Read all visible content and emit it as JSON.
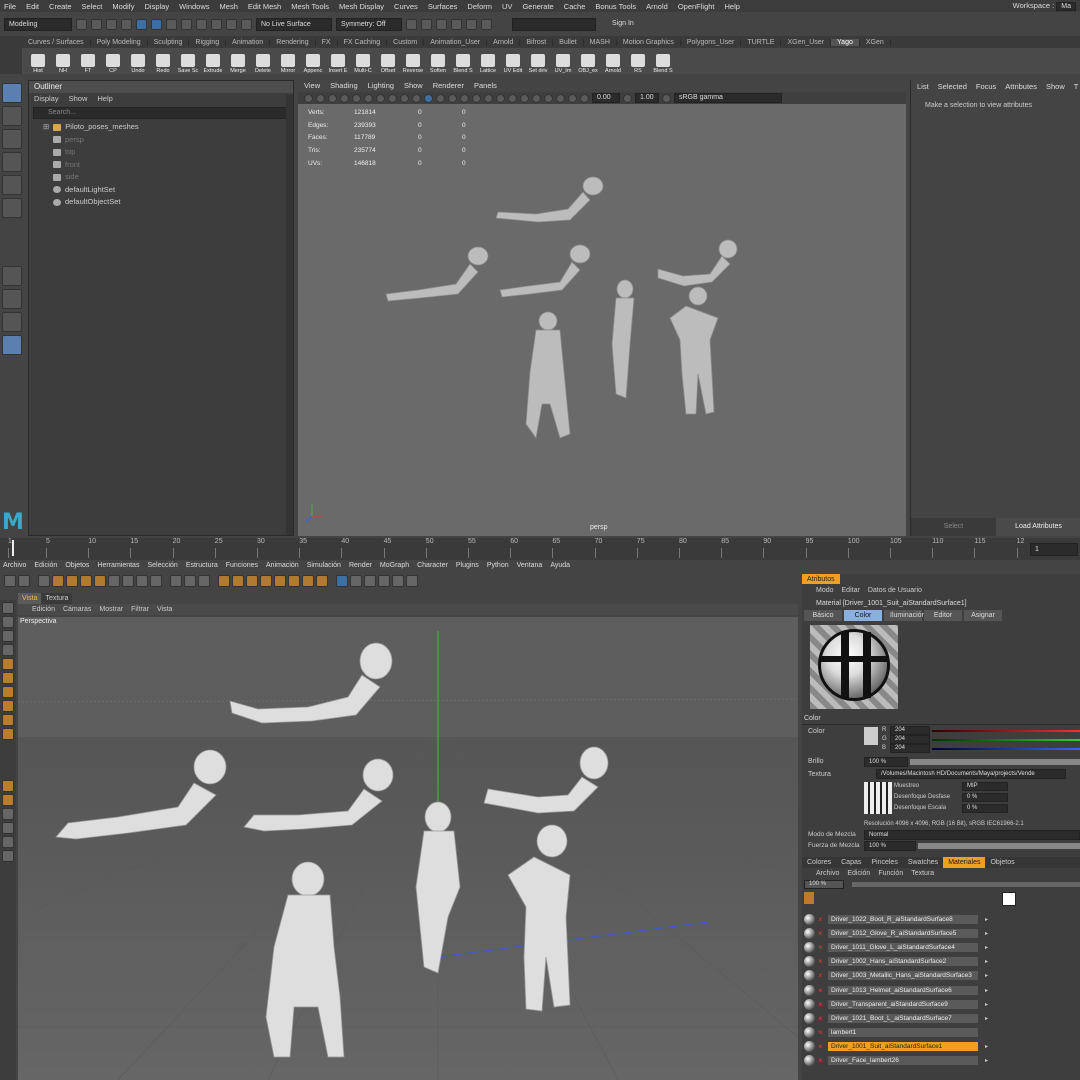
{
  "maya": {
    "menu": [
      "File",
      "Edit",
      "Create",
      "Select",
      "Modify",
      "Display",
      "Windows",
      "Mesh",
      "Edit Mesh",
      "Mesh Tools",
      "Mesh Display",
      "Curves",
      "Surfaces",
      "Deform",
      "UV",
      "Generate",
      "Cache",
      "Bonus Tools",
      "Arnold",
      "OpenFlight",
      "Help"
    ],
    "workspace": "Workspace :",
    "workspace_value": "Ma",
    "mode": "Modeling",
    "live_surface": "No Live Surface",
    "symmetry": "Symmetry: Off",
    "sign_in": "Sign In",
    "shelf_tabs": [
      "Curves / Surfaces",
      "Poly Modeling",
      "Sculpting",
      "Rigging",
      "Animation",
      "Rendering",
      "FX",
      "FX Caching",
      "Custom",
      "Animation_User",
      "Arnold",
      "Bifrost",
      "Bullet",
      "MASH",
      "Motion Graphics",
      "Polygons_User",
      "TURTLE",
      "XGen_User",
      "Yago",
      "XGen"
    ],
    "active_shelf_tab": "Yago",
    "shelf_buttons": [
      "Hist",
      "NH",
      "FT",
      "CP",
      "Undo",
      "Redo",
      "Save Sc",
      "Extrude",
      "Merge",
      "Delete",
      "Mirror",
      "Appenc",
      "Insert E",
      "Multi-C",
      "Offset",
      "Reverse",
      "Soften",
      "Blend S",
      "Lattice",
      "UV Edit",
      "Set driv",
      "UV_Im",
      "OBJ_ex",
      "Arnold",
      "RS",
      "Blend S"
    ],
    "outliner": {
      "title": "Outliner",
      "menu": [
        "Display",
        "Show",
        "Help"
      ],
      "search_placeholder": "Search...",
      "items": [
        {
          "label": "Piloto_poses_meshes",
          "type": "group"
        },
        {
          "label": "persp",
          "type": "camera"
        },
        {
          "label": "top",
          "type": "camera"
        },
        {
          "label": "front",
          "type": "camera"
        },
        {
          "label": "side",
          "type": "camera"
        },
        {
          "label": "defaultLightSet",
          "type": "set"
        },
        {
          "label": "defaultObjectSet",
          "type": "set"
        }
      ]
    },
    "viewport": {
      "menu": [
        "View",
        "Shading",
        "Lighting",
        "Show",
        "Renderer",
        "Panels"
      ],
      "exposure": "0.00",
      "gamma": "1.00",
      "color_space": "sRGB gamma",
      "camera_label": "persp",
      "stats": [
        {
          "name": "Verts:",
          "value": "121814",
          "sel": "0",
          "comp": "0"
        },
        {
          "name": "Edges:",
          "value": "239393",
          "sel": "0",
          "comp": "0"
        },
        {
          "name": "Faces:",
          "value": "117789",
          "sel": "0",
          "comp": "0"
        },
        {
          "name": "Tris:",
          "value": "235774",
          "sel": "0",
          "comp": "0"
        },
        {
          "name": "UVs:",
          "value": "146818",
          "sel": "0",
          "comp": "0"
        }
      ]
    },
    "attribute_editor": {
      "menu": [
        "List",
        "Selected",
        "Focus",
        "Attributes",
        "Show",
        "T"
      ],
      "message": "Make a selection to view attributes",
      "select_btn": "Select",
      "load_btn": "Load Attributes"
    },
    "timeline": {
      "ticks": [
        "1",
        "5",
        "10",
        "15",
        "20",
        "25",
        "30",
        "35",
        "40",
        "45",
        "50",
        "55",
        "60",
        "65",
        "70",
        "75",
        "80",
        "85",
        "90",
        "95",
        "100",
        "105",
        "110",
        "115",
        "12"
      ],
      "current_frame": "1"
    }
  },
  "c4d": {
    "menu": [
      "Archivo",
      "Edición",
      "Objetos",
      "Herramientas",
      "Selección",
      "Estructura",
      "Funciones",
      "Animación",
      "Simulación",
      "Render",
      "MoGraph",
      "Character",
      "Plugins",
      "Python",
      "Ventana",
      "Ayuda"
    ],
    "vp_tabs": [
      "Vista",
      "Textura"
    ],
    "vp_menu": [
      "Edición",
      "Cámaras",
      "Mostrar",
      "Filtrar",
      "Vista"
    ],
    "vp_label": "Perspectiva",
    "attributes": {
      "title": "Atributos",
      "menu": [
        "Modo",
        "Editar",
        "Datos de Usuario"
      ],
      "material_title": "Material [Driver_1001_Suit_aiStandardSurface1]",
      "tabs": [
        "Básico",
        "Color",
        "Iluminación",
        "Editor",
        "Asignar"
      ],
      "active_tab": "Color",
      "section": "Color",
      "color_label": "Color",
      "r": "204",
      "g": "204",
      "b": "204",
      "brillo_label": "Brillo",
      "brillo_value": "100 %",
      "brillo_fraction": 1.0,
      "textura_label": "Textura",
      "textura_path": "/Volumes/Macintosh HD/Documents/Maya/projects/Vende",
      "muestreo_label": "Muestreo",
      "muestreo_value": "MIP",
      "desenfoque_desfase_label": "Desenfoque Desfase",
      "desenfoque_desfase_value": "0 %",
      "desenfoque_escala_label": "Desenfoque Escala",
      "desenfoque_escala_value": "0 %",
      "resolucion": "Resolución 4096 x 4096, RGB (16 Bit), sRGB IEC61966-2.1",
      "modo_mezcla_label": "Modo de Mezcla",
      "modo_mezcla_value": "Normal",
      "fuerza_mezcla_label": "Fuerza de Mezcla",
      "fuerza_mezcla_value": "100 %"
    },
    "bottom_tabs": [
      "Colores",
      "Capas",
      "Pinceles",
      "Swatches",
      "Materiales",
      "Objetos"
    ],
    "active_bottom_tab": "Materiales",
    "mat_menu": [
      "Archivo",
      "Edición",
      "Función",
      "Textura"
    ],
    "zoom": "100 %",
    "materials": [
      "Driver_1022_Boot_R_aiStandardSurface8",
      "Driver_1012_Glove_R_aiStandardSurface5",
      "Driver_1011_Glove_L_aiStandardSurface4",
      "Driver_1002_Hans_aiStandardSurface2",
      "Driver_1003_Metallic_Hans_aiStandardSurface3",
      "Driver_1013_Helmet_aiStandardSurface6",
      "Driver_Transparent_aiStandardSurface9",
      "Driver_1021_Boot_L_aiStandardSurface7",
      "lambert1",
      "Driver_1001_Suit_aiStandardSurface1",
      "Driver_Face_lambert26"
    ],
    "selected_material": "Driver_1001_Suit_aiStandardSurface1"
  },
  "colors": {
    "maya_accent": "#5a7fb0",
    "c4d_accent": "#f0a020",
    "red": "#e33333"
  }
}
